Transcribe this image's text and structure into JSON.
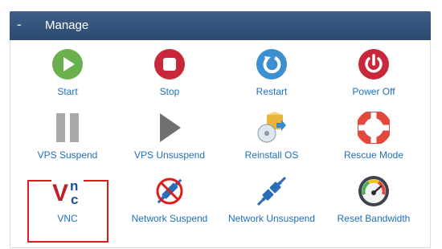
{
  "header": {
    "toggle": "-",
    "title": "Manage"
  },
  "items": [
    {
      "label": "Start",
      "icon": "play-icon"
    },
    {
      "label": "Stop",
      "icon": "stop-icon"
    },
    {
      "label": "Restart",
      "icon": "restart-icon"
    },
    {
      "label": "Power Off",
      "icon": "power-icon"
    },
    {
      "label": "VPS Suspend",
      "icon": "pause-icon"
    },
    {
      "label": "VPS Unsuspend",
      "icon": "play-gray-icon"
    },
    {
      "label": "Reinstall OS",
      "icon": "install-icon"
    },
    {
      "label": "Rescue Mode",
      "icon": "lifebuoy-icon"
    },
    {
      "label": "VNC",
      "icon": "vnc-icon"
    },
    {
      "label": "Network Suspend",
      "icon": "network-blocked-icon"
    },
    {
      "label": "Network Unsuspend",
      "icon": "network-plug-icon"
    },
    {
      "label": "Reset Bandwidth",
      "icon": "gauge-icon"
    }
  ],
  "vnc_logo": {
    "v": "V",
    "n": "n",
    "c": "c"
  },
  "colors": {
    "link": "#1f6fb8",
    "highlight": "#e11a1a",
    "header": "#2d4a70"
  }
}
